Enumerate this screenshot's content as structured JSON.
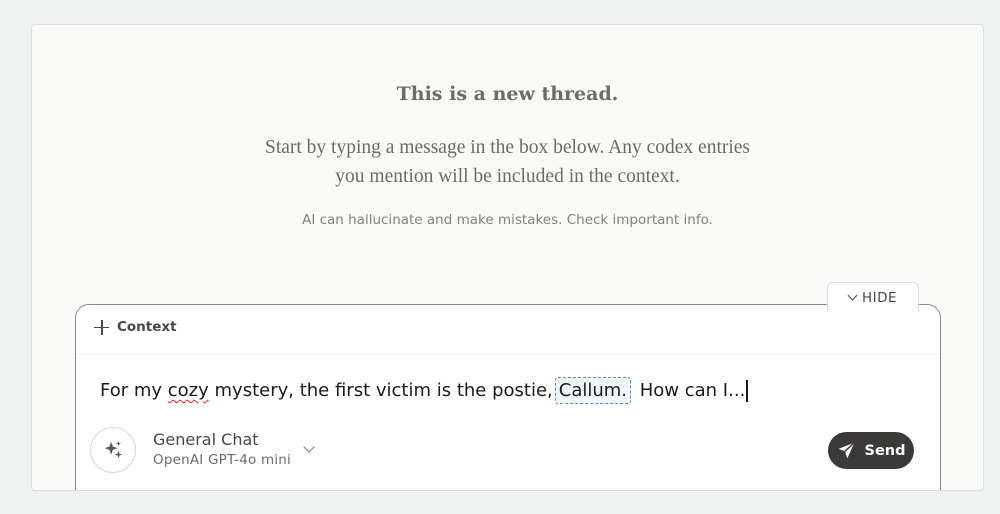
{
  "empty_state": {
    "title": "This is a new thread.",
    "description_line1": "Start by typing a message in the box below. Any codex entries",
    "description_line2": "you mention will be included in the context.",
    "disclaimer": "AI can hallucinate and make mistakes. Check important info."
  },
  "hide_tab": {
    "label": "HIDE",
    "icon": "chevron-down-icon"
  },
  "composer": {
    "context_label": "Context",
    "context_icon": "plus-icon",
    "message": {
      "part1": "For my ",
      "misspelled": "cozy",
      "part2": " mystery, the first victim is the postie,",
      "mention": "Callum.",
      "part3": " How can I..."
    },
    "model": {
      "name": "General Chat",
      "provider": "OpenAI GPT-4o mini",
      "icon": "sparkle-icon"
    },
    "send_label": "Send",
    "send_icon": "paper-plane-icon"
  },
  "colors": {
    "background": "#eef3f2",
    "panel": "#f9f9f8",
    "send_button": "#3c3a39",
    "mention_border": "#5d8fa6",
    "spellcheck": "#d8322e"
  }
}
